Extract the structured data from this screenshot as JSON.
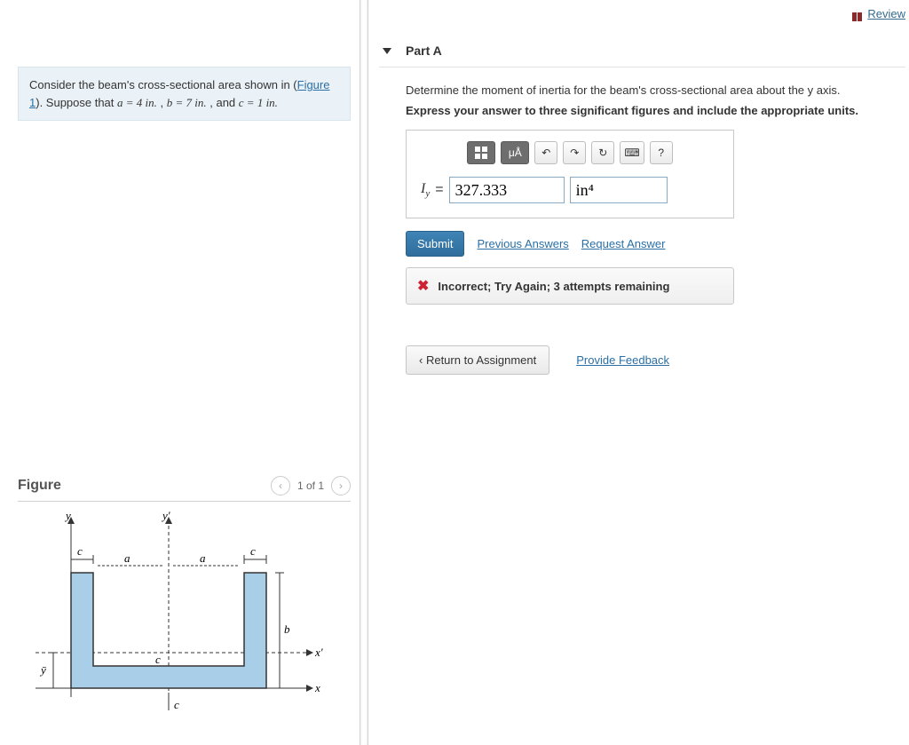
{
  "review": {
    "label": "Review"
  },
  "problem": {
    "line1_pre": "Consider the beam's cross-sectional area shown in (",
    "figure_link": "Figure 1",
    "line1_post": "). Suppose that ",
    "a_expr": "a = 4  in.",
    "sep1": " , ",
    "b_expr": "b = 7  in.",
    "sep2": " , and ",
    "c_expr": "c = 1 in."
  },
  "figure": {
    "title": "Figure",
    "pager": "1 of 1",
    "labels": {
      "y": "y",
      "yprime": "y'",
      "x": "x",
      "xprime": "x'",
      "a": "a",
      "b": "b",
      "c": "c",
      "ybar": "ȳ"
    }
  },
  "part": {
    "title": "Part A",
    "instruction1": "Determine the moment of inertia for the beam's cross-sectional area about the y axis.",
    "instruction2": "Express your answer to three significant figures and include the appropriate units.",
    "toolbar": {
      "templates_tip": "Templates",
      "symbols": "μÅ",
      "undo": "↶",
      "redo": "↷",
      "reset": "↻",
      "keyboard": "⌨",
      "help": "?"
    },
    "answer": {
      "lhs_sym": "I",
      "lhs_sub": "y",
      "equals": " = ",
      "value": "327.333",
      "units": "in⁴"
    },
    "buttons": {
      "submit": "Submit",
      "previous": "Previous Answers",
      "request": "Request Answer"
    },
    "feedback": "Incorrect; Try Again; 3 attempts remaining"
  },
  "footer": {
    "return": "Return to Assignment",
    "provide": "Provide Feedback"
  }
}
